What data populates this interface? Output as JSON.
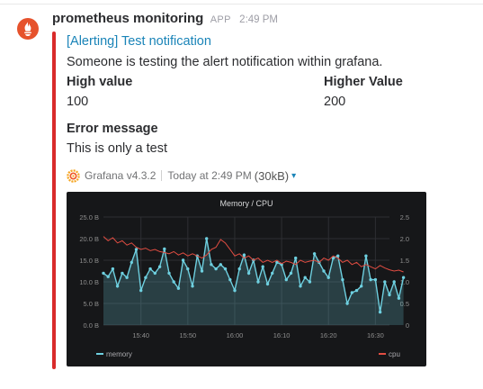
{
  "message": {
    "sender": "prometheus monitoring",
    "app_tag": "APP",
    "time": "2:49 PM"
  },
  "attachment": {
    "title": "[Alerting] Test notification",
    "text": "Someone is testing the alert notification within grafana.",
    "accent_color": "#d92b2b",
    "fields": [
      {
        "title": "High value",
        "value": "100"
      },
      {
        "title": "Higher Value",
        "value": "200"
      },
      {
        "title": "Error message",
        "value": "This is only a test"
      }
    ],
    "footer": {
      "icon": "grafana-logo-icon",
      "name": "Grafana v4.3.2",
      "time": "Today at 2:49 PM",
      "size": "(30kB)",
      "caret": "▾"
    }
  },
  "chart_data": {
    "type": "line",
    "title": "Memory / CPU",
    "x_ticks": [
      "15:40",
      "15:50",
      "16:00",
      "16:10",
      "16:20",
      "16:30"
    ],
    "x_tick_minutes": [
      0,
      10,
      20,
      30,
      40,
      50
    ],
    "x_range_minutes": [
      -8,
      53
    ],
    "y_left": {
      "ticks": [
        "0.0 B",
        "5.0 B",
        "10.0 B",
        "15.0 B",
        "20.0 B",
        "25.0 B"
      ],
      "range": [
        0,
        25
      ]
    },
    "y_right": {
      "ticks": [
        "0",
        "0.5",
        "1.0",
        "1.5",
        "2.0",
        "2.5"
      ],
      "range": [
        0,
        2.5
      ]
    },
    "grid": true,
    "legend_position": "bottom",
    "series": [
      {
        "name": "memory",
        "axis": "left",
        "color": "#6ed0e0",
        "fill": true,
        "x_start_minute": -8,
        "x_step_minute": 1,
        "values": [
          12,
          11.2,
          13,
          9,
          12,
          11,
          14.5,
          17.5,
          8,
          11,
          13,
          12,
          13.5,
          17.6,
          12,
          10,
          8.5,
          15,
          13,
          9,
          16,
          12.5,
          20,
          14,
          13,
          14,
          13,
          10.5,
          8,
          13,
          16.2,
          12,
          15,
          10,
          13.5,
          9.5,
          12,
          14.5,
          14,
          10.5,
          12,
          15.5,
          9,
          11,
          10,
          16.5,
          14.5,
          12.5,
          11,
          15.5,
          16,
          10.5,
          5,
          7.5,
          8,
          9,
          16,
          10.5,
          10.5,
          3,
          10,
          7,
          10,
          6.2,
          11
        ]
      },
      {
        "name": "cpu",
        "axis": "right",
        "color": "#e24d42",
        "fill": false,
        "x_start_minute": -8,
        "x_step_minute": 1,
        "values": [
          2.05,
          1.95,
          2.02,
          1.9,
          1.95,
          1.85,
          1.9,
          1.8,
          1.75,
          1.78,
          1.72,
          1.75,
          1.7,
          1.68,
          1.65,
          1.7,
          1.62,
          1.67,
          1.6,
          1.65,
          1.6,
          1.55,
          1.62,
          1.75,
          1.8,
          1.98,
          1.9,
          1.75,
          1.6,
          1.65,
          1.55,
          1.6,
          1.5,
          1.55,
          1.45,
          1.5,
          1.45,
          1.5,
          1.42,
          1.48,
          1.45,
          1.4,
          1.5,
          1.45,
          1.48,
          1.5,
          1.45,
          1.55,
          1.5,
          1.6,
          1.55,
          1.45,
          1.5,
          1.4,
          1.45,
          1.35,
          1.4,
          1.35,
          1.3,
          1.38,
          1.32,
          1.28,
          1.25,
          1.27,
          1.23
        ]
      }
    ]
  }
}
